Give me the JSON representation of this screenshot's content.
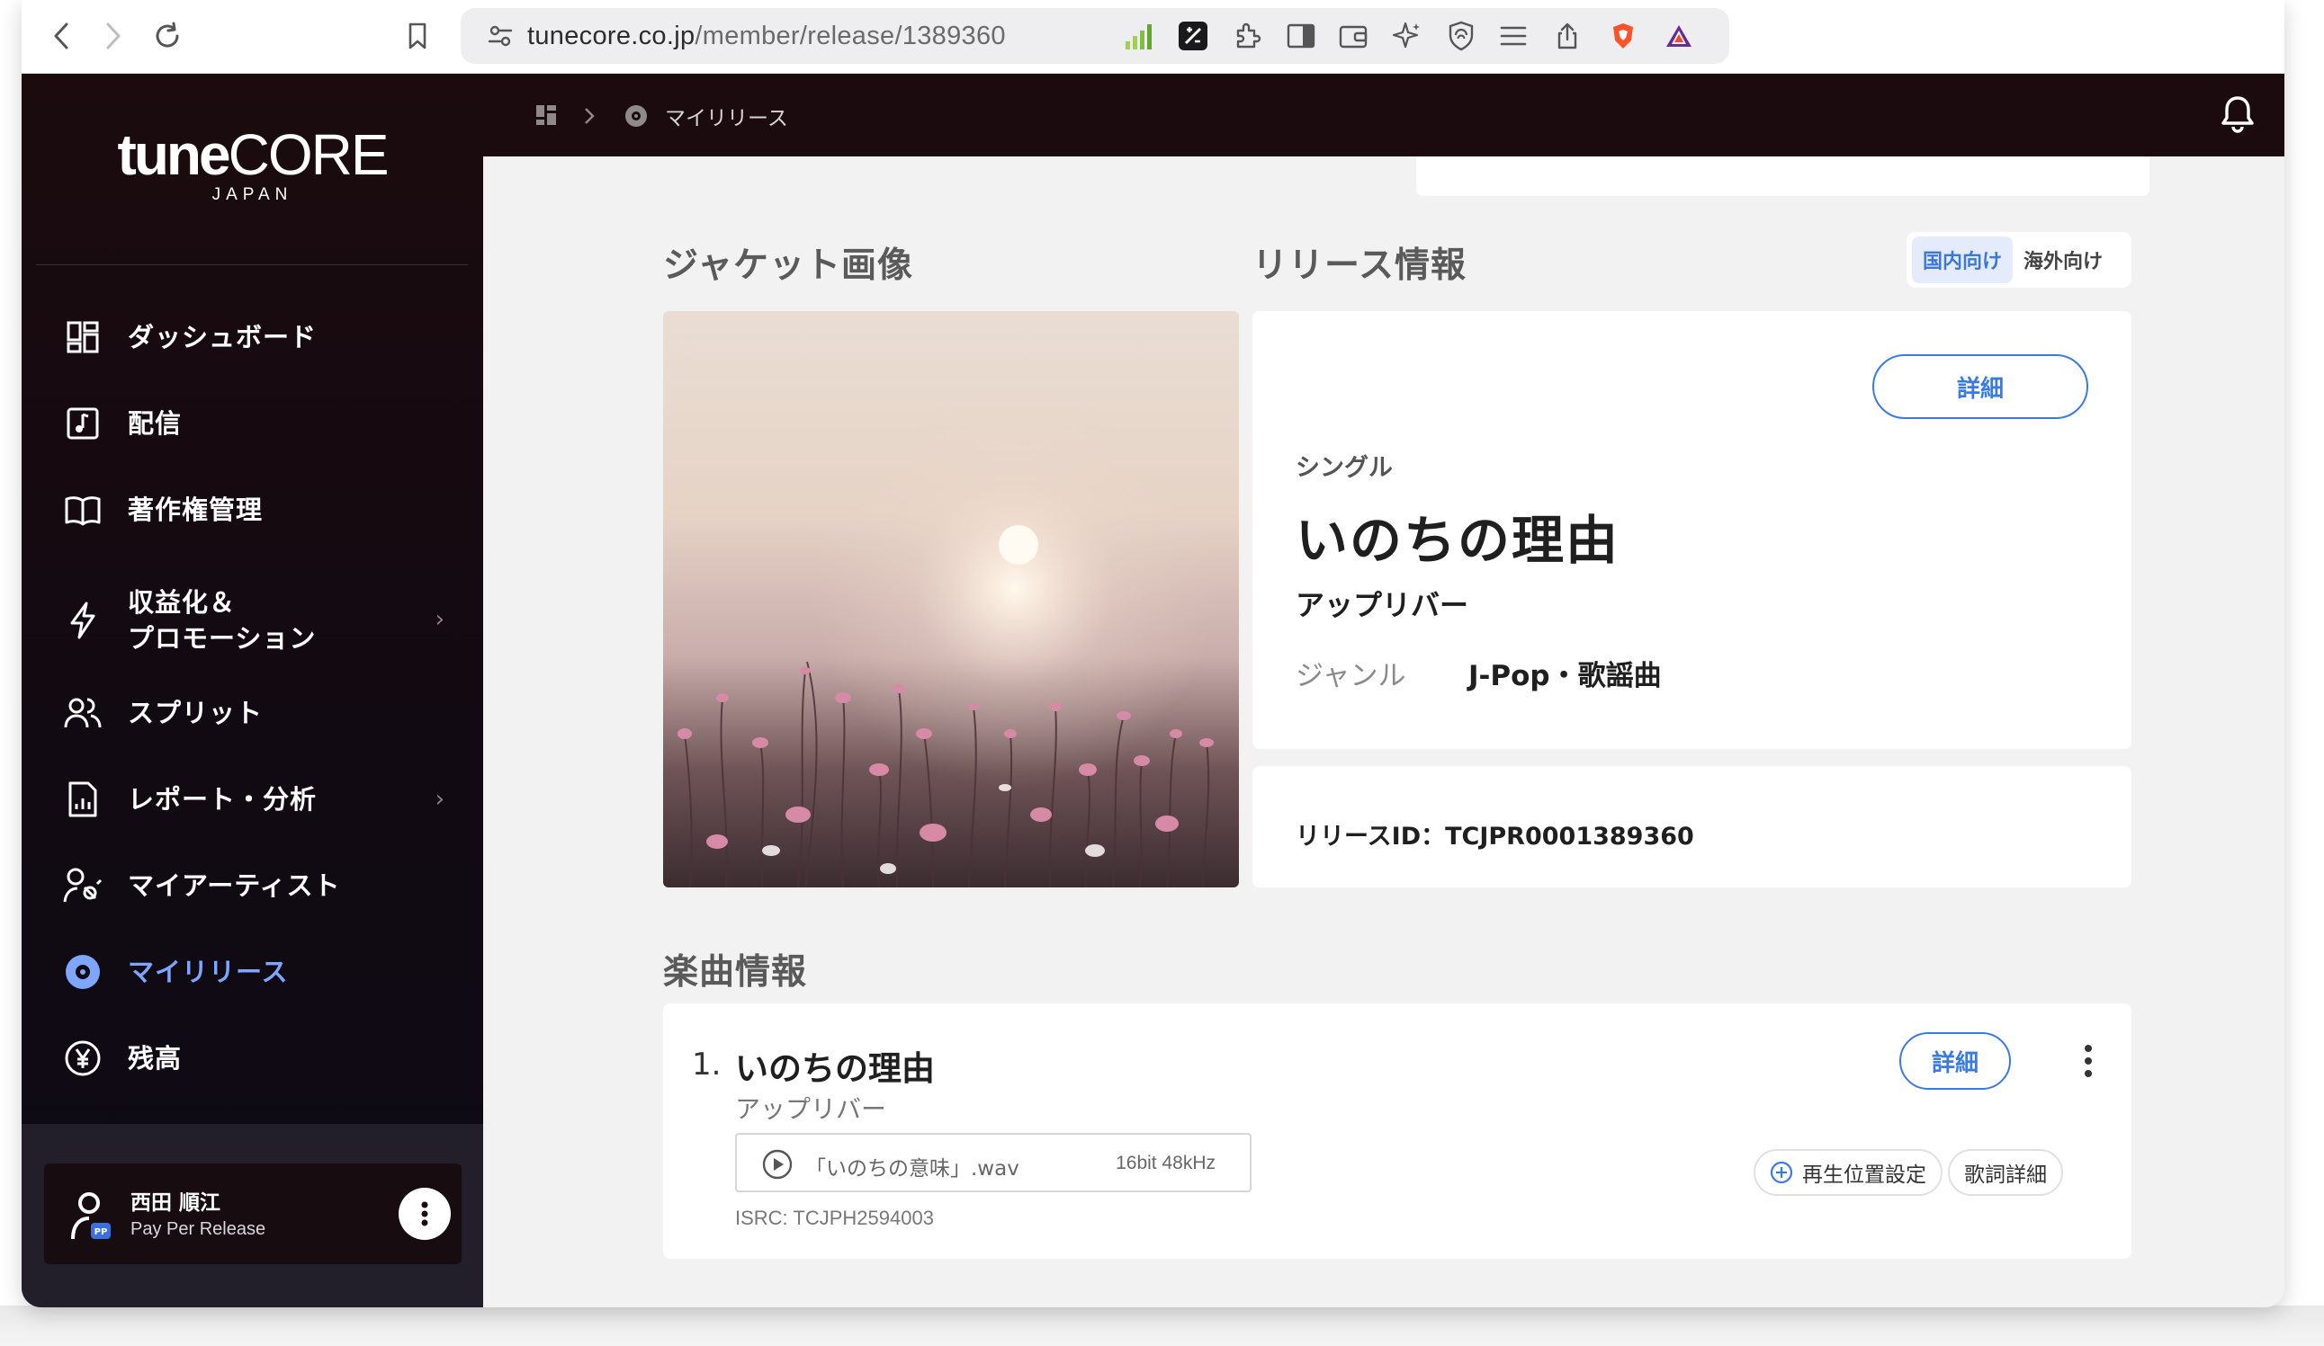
{
  "browser": {
    "url_domain": "tunecore.co.jp",
    "url_path": "/member/release/1389360"
  },
  "sidebar": {
    "logo": {
      "main_bold": "tune",
      "main_light": "CORE",
      "sub": "JAPAN"
    },
    "items": [
      {
        "label": "ダッシュボード",
        "icon": "dashboard-icon"
      },
      {
        "label": "配信",
        "icon": "music-note-icon"
      },
      {
        "label": "著作権管理",
        "icon": "book-icon"
      },
      {
        "label": "収益化＆",
        "label2": "プロモーション",
        "icon": "lightning-icon"
      },
      {
        "label": "スプリット",
        "icon": "people-icon"
      },
      {
        "label": "レポート・分析",
        "icon": "report-icon"
      },
      {
        "label": "マイアーティスト",
        "icon": "artist-icon"
      },
      {
        "label": "マイリリース",
        "icon": "disc-icon",
        "active": true
      },
      {
        "label": "残高",
        "icon": "yen-icon"
      }
    ],
    "user": {
      "name": "西田 順江",
      "plan": "Pay Per Release",
      "badge": "PP"
    }
  },
  "topbar": {
    "breadcrumb": [
      "マイリリース"
    ]
  },
  "jacket": {
    "title": "ジャケット画像"
  },
  "release": {
    "section_title": "リリース情報",
    "toggle": {
      "domestic": "国内向け",
      "overseas": "海外向け",
      "selected": "domestic"
    },
    "detail_button": "詳細",
    "type": "シングル",
    "title": "いのちの理由",
    "artist": "アップリバー",
    "genre_label": "ジャンル",
    "genre_value": "J-Pop・歌謡曲",
    "release_id": "リリースID：TCJPR0001389360"
  },
  "tracks": {
    "section_title": "楽曲情報",
    "items": [
      {
        "number": "1.",
        "title": "いのちの理由",
        "artist": "アップリバー",
        "file_name": "「いのちの意味」.wav",
        "file_spec": "16bit 48kHz",
        "isrc": "ISRC: TCJPH2594003",
        "detail_button": "詳細",
        "position_button": "再生位置設定",
        "lyrics_button": "歌詞詳細"
      }
    ]
  },
  "colors": {
    "accent": "#3b7ae0",
    "active_nav": "#7ea6ff",
    "sidebar_bg": "#1b0b0e",
    "main_bg": "#f2f2f2"
  }
}
